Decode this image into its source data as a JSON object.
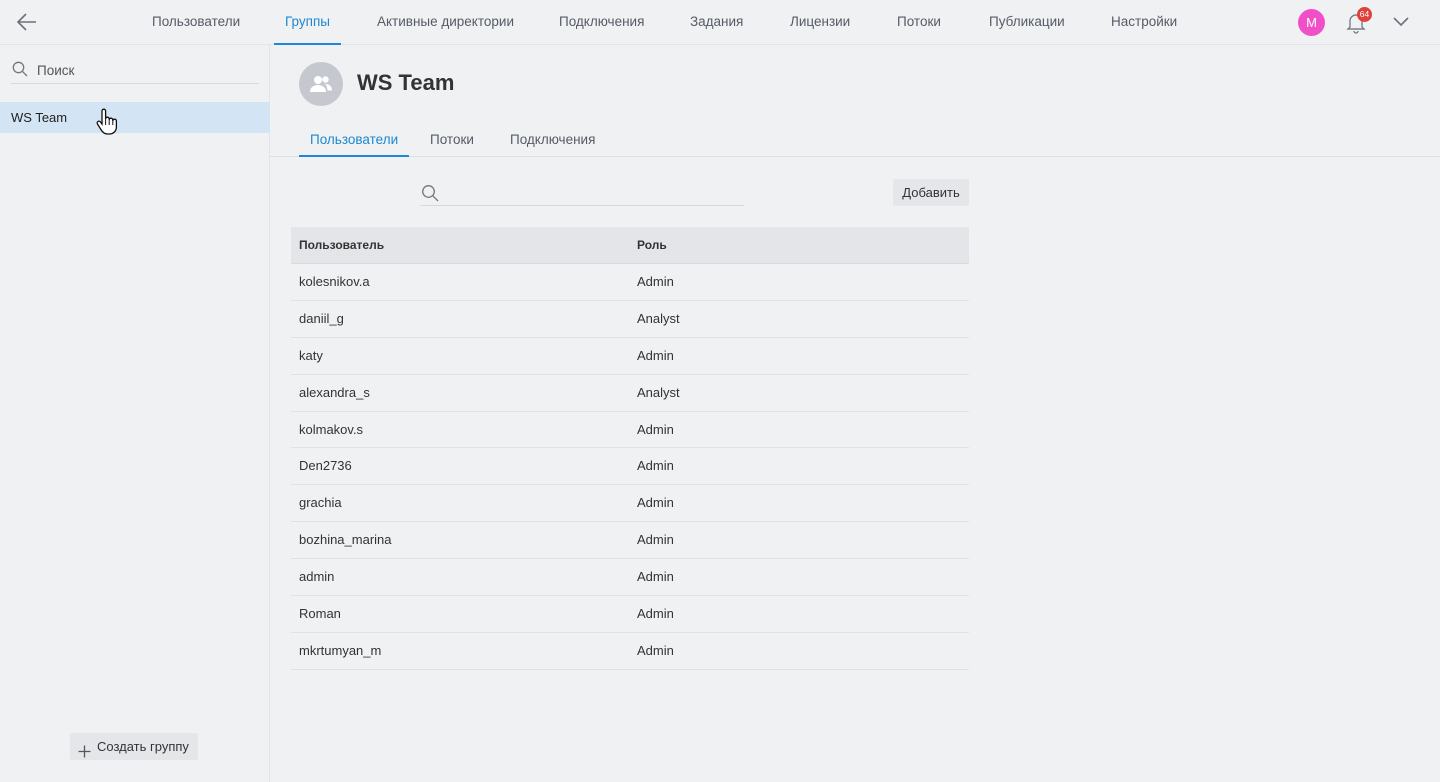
{
  "nav": {
    "items": [
      {
        "label": "Пользователи"
      },
      {
        "label": "Группы"
      },
      {
        "label": "Активные директории"
      },
      {
        "label": "Подключения"
      },
      {
        "label": "Задания"
      },
      {
        "label": "Лицензии"
      },
      {
        "label": "Потоки"
      },
      {
        "label": "Публикации"
      },
      {
        "label": "Настройки"
      }
    ],
    "active": "Группы",
    "avatar_letter": "M",
    "notification_count": "64",
    "accent_color": "#1e88d0",
    "avatar_color": "#f04fc8"
  },
  "sidebar": {
    "search_placeholder": "Поиск",
    "groups": [
      {
        "label": "WS Team"
      }
    ],
    "create_label": "Создать группу"
  },
  "group": {
    "title": "WS Team",
    "tabs": [
      {
        "label": "Пользователи"
      },
      {
        "label": "Потоки"
      },
      {
        "label": "Подключения"
      }
    ],
    "active_tab": "Пользователи",
    "search_placeholder": "",
    "add_label": "Добавить"
  },
  "table": {
    "headers": {
      "user": "Пользователь",
      "role": "Роль"
    },
    "rows": [
      {
        "user": "kolesnikov.a",
        "role": "Admin"
      },
      {
        "user": "daniil_g",
        "role": "Analyst"
      },
      {
        "user": "katy",
        "role": "Admin"
      },
      {
        "user": "alexandra_s",
        "role": "Analyst"
      },
      {
        "user": "kolmakov.s",
        "role": "Admin"
      },
      {
        "user": "Den2736",
        "role": "Admin"
      },
      {
        "user": "grachia",
        "role": "Admin"
      },
      {
        "user": "bozhina_marina",
        "role": "Admin"
      },
      {
        "user": "admin",
        "role": "Admin"
      },
      {
        "user": "Roman",
        "role": "Admin"
      },
      {
        "user": "mkrtumyan_m",
        "role": "Admin"
      }
    ]
  }
}
